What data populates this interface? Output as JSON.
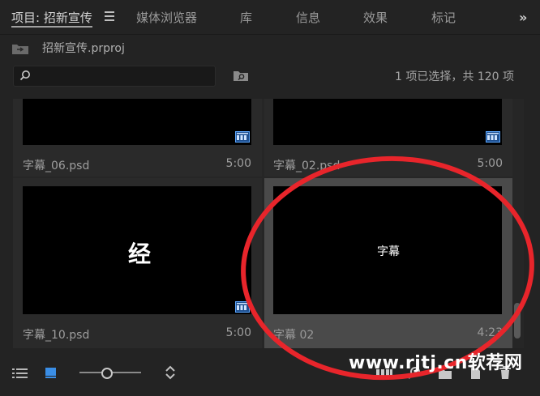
{
  "tabs": [
    {
      "label": "项目: 招新宣传",
      "active": true
    },
    {
      "label": "媒体浏览器"
    },
    {
      "label": "库"
    },
    {
      "label": "信息"
    },
    {
      "label": "效果"
    },
    {
      "label": "标记"
    }
  ],
  "overflow_chevron": "»",
  "project": {
    "name": "招新宣传.prproj"
  },
  "search": {
    "placeholder": "",
    "value": ""
  },
  "selection_status": "1 项已选择，共 120 项",
  "items": [
    {
      "name": "字幕_06.psd",
      "duration": "5:00",
      "thumb_text": ""
    },
    {
      "name": "字幕_02.psd",
      "duration": "5:00",
      "thumb_text": ""
    },
    {
      "name": "字幕_10.psd",
      "duration": "5:00",
      "thumb_text": "经"
    },
    {
      "name": "字幕 02",
      "duration": "4:23",
      "thumb_text": "字幕",
      "selected": true
    }
  ],
  "zoom_level": 0.45,
  "watermark": "www.rjtj.cn软荐网",
  "icons": [
    "search-icon",
    "bin-icon",
    "list-view-icon",
    "icon-view-icon",
    "sort-icon",
    "automate-icon",
    "find-icon",
    "new-bin-icon",
    "new-item-icon",
    "trash-icon",
    "sequence-badge-icon",
    "project-file-icon"
  ],
  "colors": {
    "background": "#232323",
    "selected_cell": "#4a4a4a",
    "badge_blue": "#3a8ee6",
    "annotation_red": "#e8252b"
  }
}
